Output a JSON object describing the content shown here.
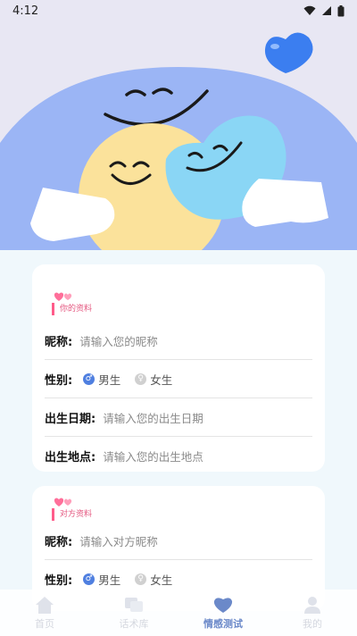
{
  "status_bar": {
    "time": "4:12",
    "icons": [
      "wifi-icon",
      "signal-icon",
      "battery-icon"
    ]
  },
  "hero": {
    "illustration": "smiling-faces-illustration",
    "colors": {
      "sky": "#e8e7f3",
      "blue_disc": "#9bb5f5",
      "yellow_face": "#fbe29b",
      "cyan_heart": "#8ad6f5",
      "heart": "#3b7ef0"
    }
  },
  "self_profile": {
    "section_title": "你的资料",
    "nickname_label": "昵称:",
    "nickname_placeholder": "请输入您的昵称",
    "gender_label": "性别:",
    "male_label": "男生",
    "female_label": "女生",
    "selected_gender": "男生",
    "birth_date_label": "出生日期:",
    "birth_date_placeholder": "请输入您的出生日期",
    "birth_place_label": "出生地点:",
    "birth_place_placeholder": "请输入您的出生地点"
  },
  "partner_profile": {
    "section_title": "对方资料",
    "nickname_label": "昵称:",
    "nickname_placeholder": "请输入对方昵称",
    "gender_label": "性别:",
    "male_label": "男生",
    "female_label": "女生",
    "selected_gender": "男生"
  },
  "bottom_nav": {
    "items": [
      {
        "label": "首页",
        "icon": "home-icon",
        "active": false
      },
      {
        "label": "话术库",
        "icon": "chat-icon",
        "active": false
      },
      {
        "label": "情感测试",
        "icon": "heart-icon",
        "active": true
      },
      {
        "label": "我的",
        "icon": "user-icon",
        "active": false
      }
    ]
  },
  "colors": {
    "accent": "#6b89c9",
    "pink": "#ff5c8a",
    "radio_on": "#4f7fe0"
  }
}
